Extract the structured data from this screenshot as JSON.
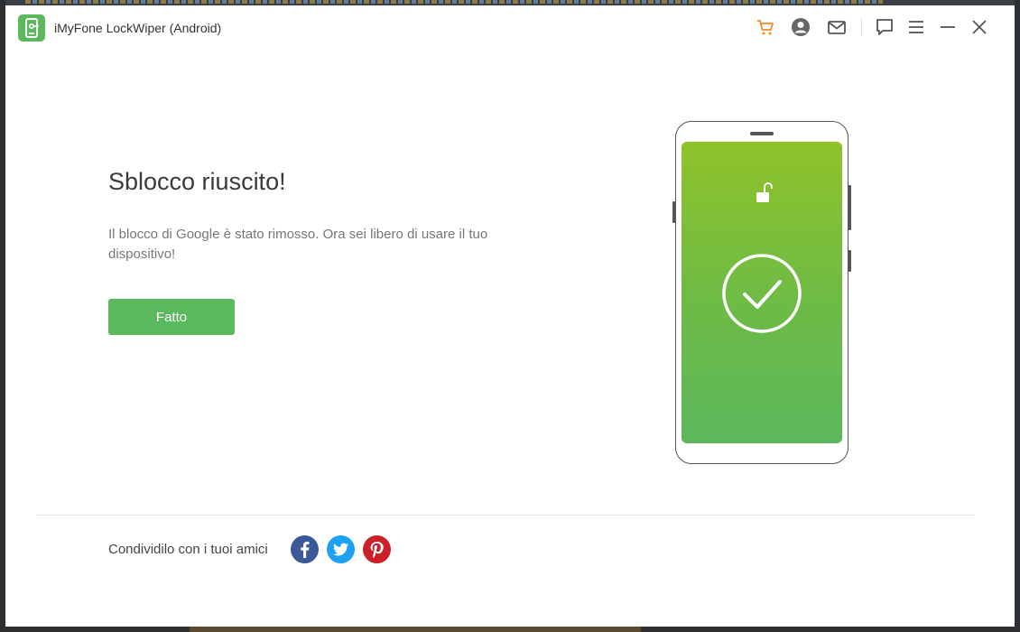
{
  "window": {
    "title": "iMyFone LockWiper (Android)"
  },
  "titlebar": {
    "icons": [
      "cart-icon",
      "account-icon",
      "mail-icon",
      "feedback-icon",
      "menu-icon",
      "minimize-icon",
      "close-icon"
    ]
  },
  "main": {
    "headline": "Sblocco riuscito!",
    "message": "Il blocco di Google è stato rimosso. Ora sei libero di usare il tuo dispositivo!",
    "done_label": "Fatto"
  },
  "footer": {
    "share_label": "Condividilo con i tuoi amici",
    "social": [
      "facebook-icon",
      "twitter-icon",
      "pinterest-icon"
    ]
  },
  "colors": {
    "accent_green": "#5cb85c",
    "cart_orange": "#f08a24",
    "facebook": "#3b5998",
    "twitter": "#1da1f2",
    "pinterest": "#cb2027"
  }
}
